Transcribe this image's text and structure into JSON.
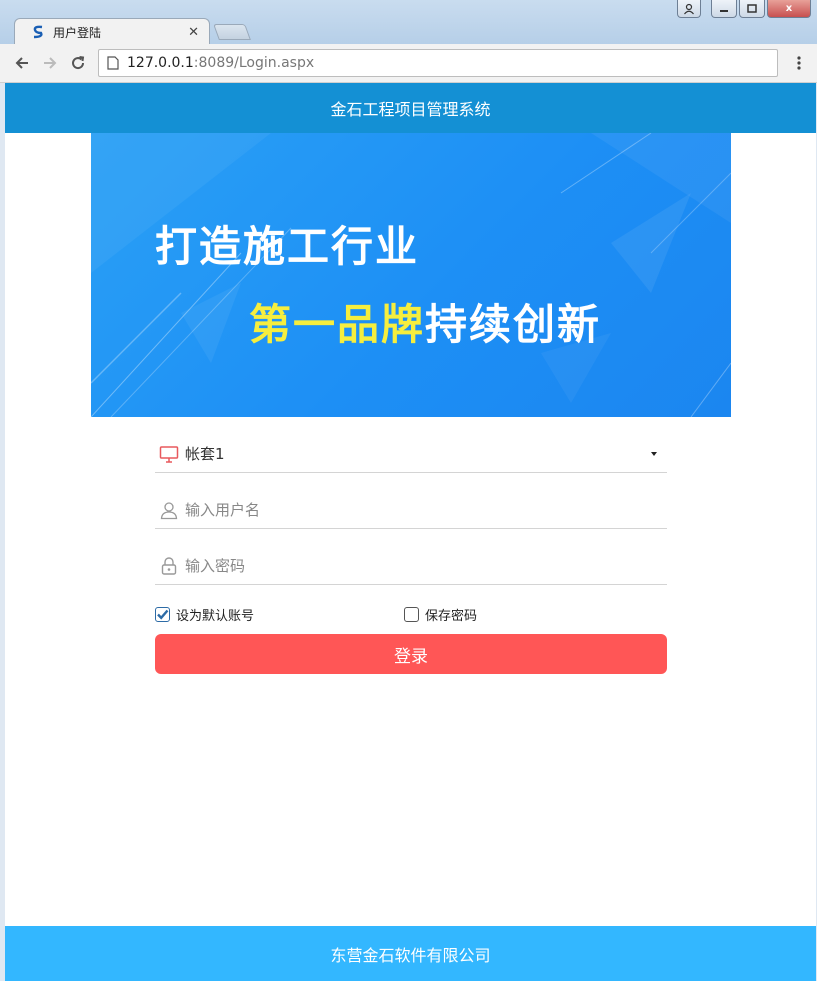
{
  "browser": {
    "tab_title": "用户登陆",
    "url_host": "127.0.0.1",
    "url_path": ":8089/Login.aspx",
    "close_glyph": "x"
  },
  "header": {
    "title": "金石工程项目管理系统"
  },
  "banner": {
    "line1": "打造施工行业",
    "line2_highlight": "第一品牌",
    "line2_rest": "持续创新",
    "highlight_color": "#f6ee3e"
  },
  "form": {
    "account_set": {
      "value": "帐套1",
      "icon": "monitor-icon"
    },
    "username": {
      "placeholder": "输入用户名",
      "icon": "user-icon"
    },
    "password": {
      "placeholder": "输入密码",
      "icon": "lock-icon"
    },
    "default_account": {
      "label": "设为默认账号",
      "checked": true
    },
    "save_password": {
      "label": "保存密码",
      "checked": false
    },
    "login_label": "登录"
  },
  "footer": {
    "text": "东营金石软件有限公司"
  },
  "colors": {
    "header_bg": "#1490d4",
    "footer_bg": "#33b7ff",
    "login_bg": "#ff5656",
    "banner_bg": "#1d8ff5"
  }
}
